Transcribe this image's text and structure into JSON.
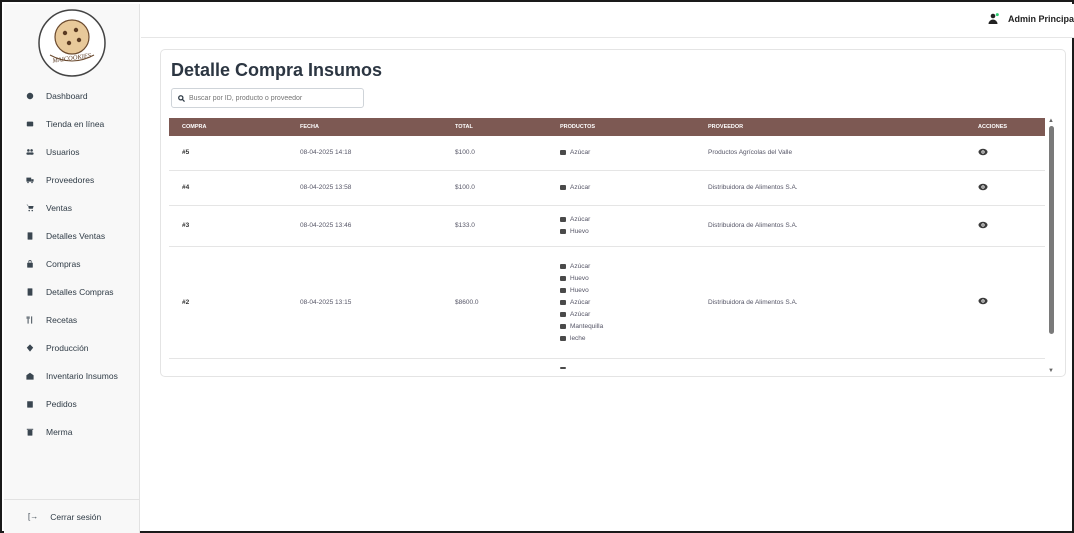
{
  "logo": {
    "text": "MAICOOKIES"
  },
  "sidebar": {
    "items": [
      {
        "label": "Dashboard",
        "icon": "dashboard-icon"
      },
      {
        "label": "Tienda en línea",
        "icon": "store-icon"
      },
      {
        "label": "Usuarios",
        "icon": "users-icon"
      },
      {
        "label": "Proveedores",
        "icon": "truck-icon"
      },
      {
        "label": "Ventas",
        "icon": "cart-icon"
      },
      {
        "label": "Detalles Ventas",
        "icon": "file-icon"
      },
      {
        "label": "Compras",
        "icon": "bag-icon"
      },
      {
        "label": "Detalles Compras",
        "icon": "file-icon"
      },
      {
        "label": "Recetas",
        "icon": "utensils-icon"
      },
      {
        "label": "Producción",
        "icon": "production-icon"
      },
      {
        "label": "Inventario Insumos",
        "icon": "warehouse-icon"
      },
      {
        "label": "Pedidos",
        "icon": "clipboard-icon"
      },
      {
        "label": "Merma",
        "icon": "trash-icon"
      }
    ],
    "logout_label": "Cerrar sesión"
  },
  "topbar": {
    "user_name": "Admin Principa"
  },
  "main": {
    "title": "Detalle Compra Insumos",
    "search_placeholder": "Buscar por ID, producto o proveedor"
  },
  "table": {
    "headers": [
      "COMPRA",
      "FECHA",
      "TOTAL",
      "PRODUCTOS",
      "PROVEEDOR",
      "ACCIONES"
    ],
    "rows": [
      {
        "id": "#5",
        "fecha": "08-04-2025 14:18",
        "total": "$100.0",
        "productos": [
          "Azúcar"
        ],
        "proveedor": "Productos Agrícolas del Valle"
      },
      {
        "id": "#4",
        "fecha": "08-04-2025 13:58",
        "total": "$100.0",
        "productos": [
          "Azúcar"
        ],
        "proveedor": "Distribuidora de Alimentos S.A."
      },
      {
        "id": "#3",
        "fecha": "08-04-2025 13:46",
        "total": "$133.0",
        "productos": [
          "Azúcar",
          "Huevo"
        ],
        "proveedor": "Distribuidora de Alimentos S.A."
      },
      {
        "id": "#2",
        "fecha": "08-04-2025 13:15",
        "total": "$8600.0",
        "productos": [
          "Azúcar",
          "Huevo",
          "Huevo",
          "Azúcar",
          "Azúcar",
          "Mantequilla",
          "leche"
        ],
        "proveedor": "Distribuidora de Alimentos S.A."
      }
    ]
  },
  "colors": {
    "header_bg": "#7d5953",
    "accent": "#2ecc71"
  }
}
